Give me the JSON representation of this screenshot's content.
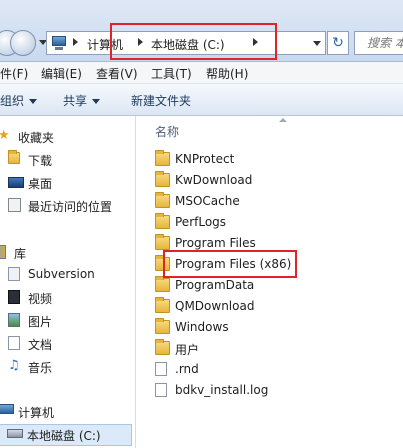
{
  "address": {
    "crumbs": [
      "计算机",
      "本地磁盘 (C:)"
    ],
    "search_placeholder": "搜索 本地"
  },
  "menu": [
    "件(F)",
    "编辑(E)",
    "查看(V)",
    "工具(T)",
    "帮助(H)"
  ],
  "commands": {
    "organize": "组织",
    "share": "共享",
    "new_folder": "新建文件夹"
  },
  "nav": {
    "favorites": "收藏夹",
    "downloads": "下载",
    "desktop": "桌面",
    "recent": "最近访问的位置",
    "libraries": "库",
    "subversion": "Subversion",
    "videos": "视频",
    "pictures": "图片",
    "documents": "文档",
    "music": "音乐",
    "computer": "计算机",
    "local_disk": "本地磁盘 (C:)"
  },
  "file_list": {
    "column_name": "名称",
    "items": [
      {
        "name": "KNProtect",
        "type": "folder"
      },
      {
        "name": "KwDownload",
        "type": "folder"
      },
      {
        "name": "MSOCache",
        "type": "folder"
      },
      {
        "name": "PerfLogs",
        "type": "folder"
      },
      {
        "name": "Program Files",
        "type": "folder"
      },
      {
        "name": "Program Files (x86)",
        "type": "folder"
      },
      {
        "name": "ProgramData",
        "type": "folder"
      },
      {
        "name": "QMDownload",
        "type": "folder"
      },
      {
        "name": "Windows",
        "type": "folder"
      },
      {
        "name": "用户",
        "type": "folder"
      },
      {
        "name": ".rnd",
        "type": "file"
      },
      {
        "name": "bdkv_install.log",
        "type": "file"
      }
    ]
  },
  "colors": {
    "highlight_box": "#e0232b",
    "selection": "#dbe9f8"
  }
}
